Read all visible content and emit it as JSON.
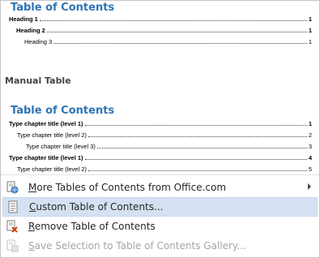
{
  "gallery": {
    "item1": {
      "title": "Table of Contents",
      "entries": [
        {
          "text": "Heading 1",
          "page": "1"
        },
        {
          "text": "Heading 2",
          "page": "1"
        },
        {
          "text": "Heading 3",
          "page": "1"
        }
      ]
    },
    "section_heading": "Manual Table",
    "item2": {
      "title": "Table of Contents",
      "entries": [
        {
          "text": "Type chapter title (level 1)",
          "page": "1"
        },
        {
          "text": "Type chapter title (level 2)",
          "page": "2"
        },
        {
          "text": "Type chapter title (level 3)",
          "page": "3"
        },
        {
          "text": "Type chapter title (level 1)",
          "page": "4"
        },
        {
          "text": "Type chapter title (level 2)",
          "page": "5"
        }
      ]
    }
  },
  "menu": {
    "items": [
      {
        "accel": "M",
        "rest": "ore Tables of Contents from Office.com",
        "icon": "globe-icon",
        "has_submenu": true,
        "disabled": false
      },
      {
        "accel": "C",
        "rest": "ustom Table of Contents...",
        "icon": "document-settings-icon",
        "has_submenu": false,
        "disabled": false
      },
      {
        "accel": "R",
        "rest": "emove Table of Contents",
        "icon": "remove-document-icon",
        "has_submenu": false,
        "disabled": false
      },
      {
        "accel": "S",
        "rest": "ave Selection to Table of Contents Gallery...",
        "icon": "save-selection-icon",
        "has_submenu": false,
        "disabled": true
      }
    ]
  },
  "colors": {
    "toc_title": "#2e74b5",
    "highlight": "#d5e1f2"
  }
}
